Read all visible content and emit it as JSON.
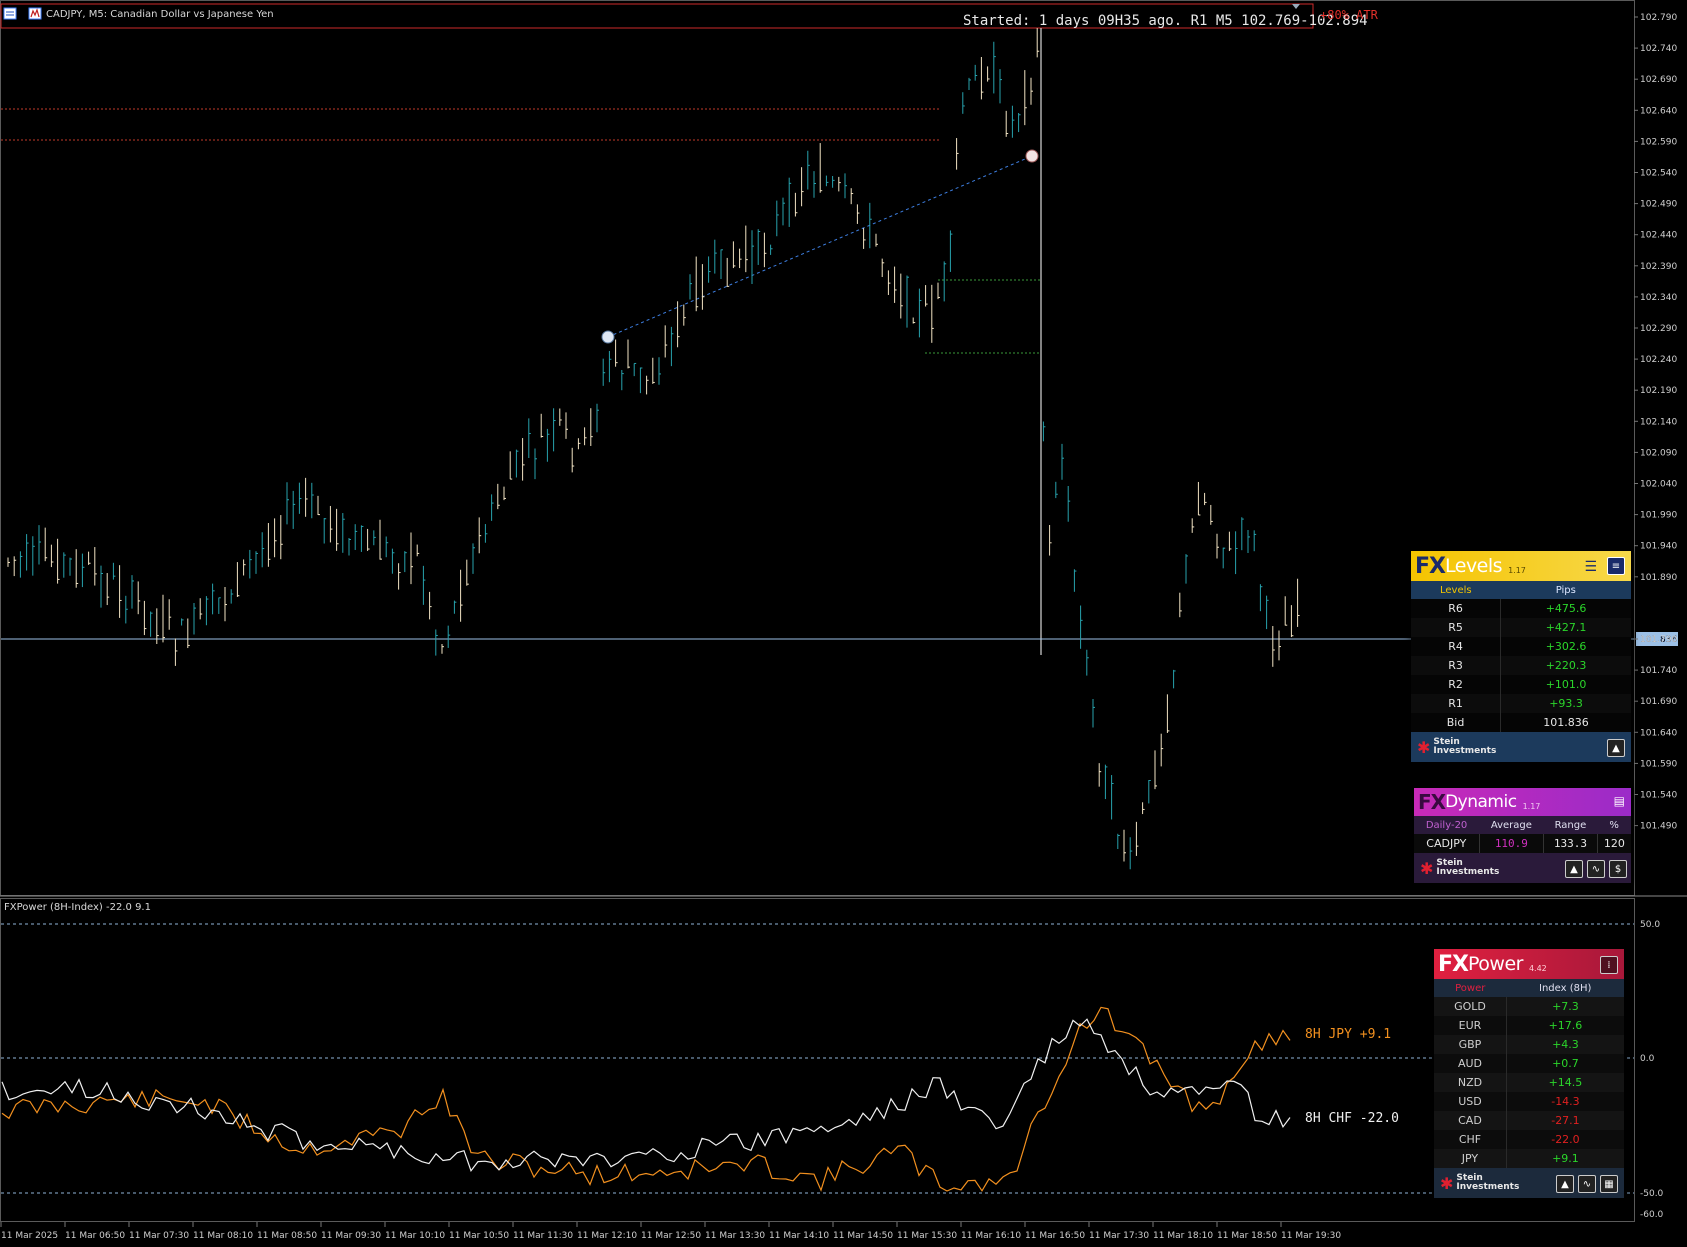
{
  "chart": {
    "symbol_header": "CADJPY, M5:  Canadian Dollar vs Japanese Yen",
    "started_text": "Started: 1 days 09H35 ago. R1 M5 102.769-102.894",
    "atr_text": "+80% ATR",
    "bid_label": "101.836",
    "price_axis": [
      "102.790",
      "102.740",
      "102.690",
      "102.640",
      "102.590",
      "102.540",
      "102.490",
      "102.440",
      "102.390",
      "102.340",
      "102.290",
      "102.240",
      "102.190",
      "102.140",
      "102.090",
      "102.040",
      "101.990",
      "101.940",
      "101.890",
      "101.836",
      "101.790",
      "101.740",
      "101.690",
      "101.640",
      "101.590",
      "101.540",
      "101.490"
    ],
    "time_axis": [
      "11 Mar 2025",
      "11 Mar 06:50",
      "11 Mar 07:30",
      "11 Mar 08:10",
      "11 Mar 08:50",
      "11 Mar 09:30",
      "11 Mar 10:10",
      "11 Mar 10:50",
      "11 Mar 11:30",
      "11 Mar 12:10",
      "11 Mar 12:50",
      "11 Mar 13:30",
      "11 Mar 14:10",
      "11 Mar 14:50",
      "11 Mar 15:30",
      "11 Mar 16:10",
      "11 Mar 16:50",
      "11 Mar 17:30",
      "11 Mar 18:10",
      "11 Mar 18:50",
      "11 Mar 19:30"
    ],
    "colors": {
      "bull": "#27a2ad",
      "bear": "#f2e4c4",
      "jpy": "#f2901f",
      "chf": "#f0f0f0",
      "grid_blue": "#8fb4d8"
    }
  },
  "indicator": {
    "header": "FXPower (8H-Index) -22.0 9.1",
    "axis": [
      "50.0",
      "0.0",
      "-50.0",
      "-60.0"
    ],
    "jpy_label": "8H JPY  +9.1",
    "chf_label": "8H CHF  -22.0"
  },
  "fxlevels": {
    "fx": "FX",
    "name": "Levels",
    "version": "1.17",
    "col_levels": "Levels",
    "col_pips": "Pips",
    "rows": [
      {
        "level": "R6",
        "pips": "+475.6"
      },
      {
        "level": "R5",
        "pips": "+427.1"
      },
      {
        "level": "R4",
        "pips": "+302.6"
      },
      {
        "level": "R3",
        "pips": "+220.3"
      },
      {
        "level": "R2",
        "pips": "+101.0"
      },
      {
        "level": "R1",
        "pips": "+93.3"
      },
      {
        "level": "Bid",
        "pips": "101.836"
      }
    ],
    "logo_line1": "Stein",
    "logo_line2": "Investments"
  },
  "fxdynamic": {
    "fx": "FX",
    "name": "Dynamic",
    "version": "1.17",
    "headers": [
      "Daily-20",
      "Average",
      "Range",
      "%"
    ],
    "row": [
      "CADJPY",
      "110.9",
      "133.3",
      "120"
    ],
    "logo_line1": "Stein",
    "logo_line2": "Investments"
  },
  "fxpower": {
    "fx": "FX",
    "name": "Power",
    "version": "4.42",
    "col_power": "Power",
    "col_index": "Index (8H)",
    "rows": [
      {
        "cur": "GOLD",
        "val": "+7.3",
        "pos": true
      },
      {
        "cur": "EUR",
        "val": "+17.6",
        "pos": true
      },
      {
        "cur": "GBP",
        "val": "+4.3",
        "pos": true
      },
      {
        "cur": "AUD",
        "val": "+0.7",
        "pos": true
      },
      {
        "cur": "NZD",
        "val": "+14.5",
        "pos": true
      },
      {
        "cur": "USD",
        "val": "-14.3",
        "pos": false
      },
      {
        "cur": "CAD",
        "val": "-27.1",
        "pos": false
      },
      {
        "cur": "CHF",
        "val": "-22.0",
        "pos": false
      },
      {
        "cur": "JPY",
        "val": "+9.1",
        "pos": true
      }
    ],
    "logo_line1": "Stein",
    "logo_line2": "Investments"
  }
}
